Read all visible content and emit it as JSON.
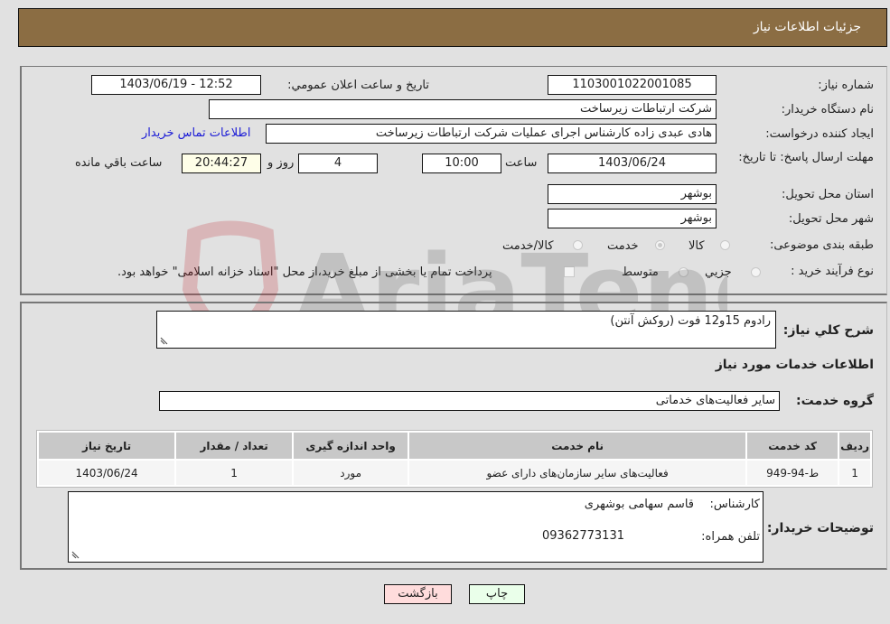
{
  "header": {
    "title": "جزئیات اطلاعات نیاز"
  },
  "fields": {
    "need_number": {
      "label": "شماره نیاز:",
      "value": "1103001022001085"
    },
    "announce_datetime": {
      "label": "تاریخ و ساعت اعلان عمومي:",
      "value": "1403/06/19 - 12:52"
    },
    "buyer_org": {
      "label": "نام دستگاه خریدار:",
      "value": "شرکت ارتباطات زیرساخت"
    },
    "requester": {
      "label": "ایجاد کننده درخواست:",
      "value": "هادی عبدی زاده کارشناس اجرای عملیات شرکت ارتباطات زیرساخت"
    },
    "buyer_contact_link": "اطلاعات تماس خریدار",
    "deadline": {
      "label": "مهلت ارسال پاسخ: تا تاریخ:",
      "date": "1403/06/24",
      "time_label": "ساعت",
      "time": "10:00",
      "days": "4",
      "days_label": "روز و",
      "remaining": "20:44:27",
      "remaining_label": "ساعت باقي مانده"
    },
    "province": {
      "label": "استان محل تحویل:",
      "value": "بوشهر"
    },
    "city": {
      "label": "شهر محل تحویل:",
      "value": "بوشهر"
    },
    "category": {
      "label": "طبقه بندی موضوعی:",
      "options": [
        "کالا",
        "خدمت",
        "کالا/خدمت"
      ],
      "selected": "خدمت"
    },
    "purchase_type": {
      "label": "نوع فرآیند خرید :",
      "options": [
        "جزيي",
        "متوسط"
      ],
      "treasury_note": "پرداخت تمام یا بخشی از مبلغ خرید،از محل \"اسناد خزانه اسلامی\" خواهد بود."
    }
  },
  "details": {
    "description_label": "شرح كلي نیاز:",
    "description": "رادوم 15و12 فوت (روکش آنتن)",
    "services_title": "اطلاعات خدمات مورد نیاز",
    "service_group_label": "گروه خدمت:",
    "service_group": "سایر فعالیت‌های خدماتی",
    "table": {
      "headers": [
        "ردیف",
        "کد خدمت",
        "نام خدمت",
        "واحد اندازه گیری",
        "تعداد / مقدار",
        "تاریخ نیاز"
      ],
      "rows": [
        [
          "1",
          "ط-94-949",
          "فعالیت‌های سایر سازمان‌های دارای عضو",
          "مورد",
          "1",
          "1403/06/24"
        ]
      ]
    },
    "buyer_notes_label": "توضیحات خریدار:",
    "buyer_notes": {
      "expert_label": "کارشناس:",
      "expert": "قاسم سهامی بوشهری",
      "phone_label": "تلفن همراه:",
      "phone": "09362773131"
    }
  },
  "buttons": {
    "print": "چاپ",
    "back": "بازگشت"
  },
  "colors": {
    "header_bg": "#8b6d43",
    "print_bg": "#eaffea",
    "back_bg": "#ffdcdc",
    "link": "#1a1ad6"
  },
  "watermark": {
    "text": "AriaTender.neT"
  }
}
